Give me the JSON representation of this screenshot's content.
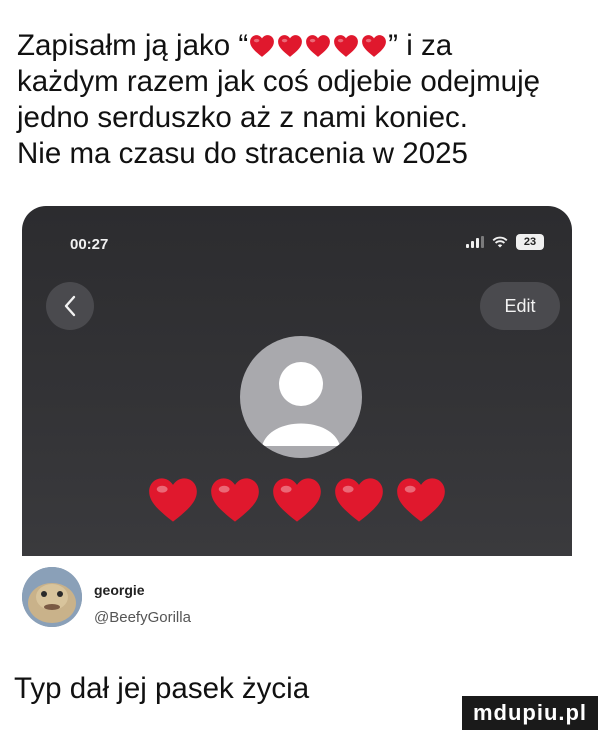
{
  "caption": {
    "line1_before": "Zapisałm ją jako “",
    "line1_after": "” i za",
    "line2": "każdym razem jak coś odjebie odejmuję",
    "line3": "jedno serduszko aż z nami koniec.",
    "line4": "Nie ma czasu do stracenia w 2025"
  },
  "phone": {
    "time": "00:27",
    "battery": "23",
    "edit_label": "Edit",
    "heart_count": 5,
    "heart_color": "#e0182d",
    "background": "#2f2f32"
  },
  "post": {
    "username": "georgie",
    "handle": "@BeefyGorilla"
  },
  "footer": {
    "text": "Typ dał jej pasek życia"
  },
  "watermark": {
    "text": "mdupiu.pl"
  }
}
